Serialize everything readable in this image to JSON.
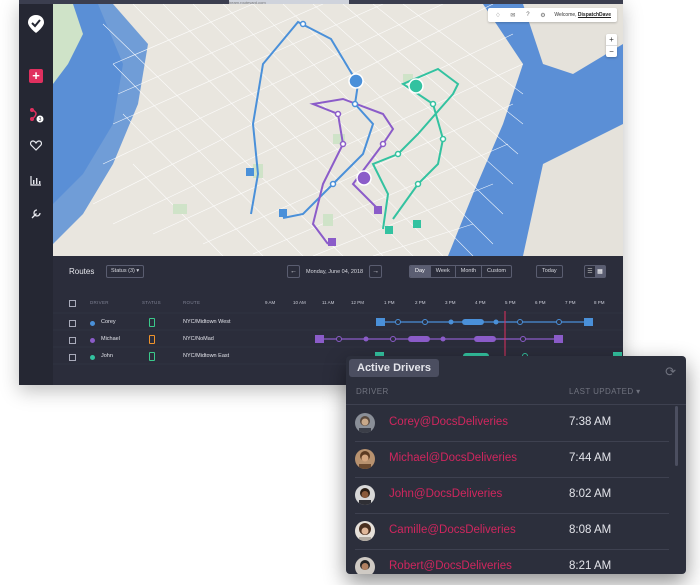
{
  "browser": {
    "url": "beam.routeyard.com"
  },
  "map_header": {
    "welcome": "Welcome,",
    "user": "DispatchDave"
  },
  "zoom": {
    "in": "+",
    "out": "−"
  },
  "routes_panel": {
    "title": "Routes",
    "status_filter": "Status (3)",
    "date": "Monday, June 04, 2018",
    "view_modes": [
      "Day",
      "Week",
      "Month",
      "Custom"
    ],
    "active_view": "Day",
    "today_label": "Today",
    "columns": {
      "driver": "DRIVER",
      "status": "STATUS",
      "route": "ROUTE"
    },
    "times": [
      "9 AM",
      "10 AM",
      "11 AM",
      "12 PM",
      "1 PM",
      "2 PM",
      "3 PM",
      "4 PM",
      "5 PM",
      "6 PM",
      "7 PM",
      "8 PM"
    ],
    "drivers": [
      {
        "name": "Corey",
        "route": "NYC/Midtown West",
        "color": "#4a90d9",
        "status_color": "#3bc98b"
      },
      {
        "name": "Michael",
        "route": "NYC/NoMad",
        "color": "#8b5cc9",
        "status_color": "#f0932b"
      },
      {
        "name": "John",
        "route": "NYC/Midtown East",
        "color": "#33c2a0",
        "status_color": "#3bc98b"
      }
    ]
  },
  "active_drivers": {
    "title": "Active Drivers",
    "columns": {
      "driver": "DRIVER",
      "last_updated": "LAST UPDATED ▾"
    },
    "rows": [
      {
        "name": "Corey@DocsDeliveries",
        "time": "7:38 AM"
      },
      {
        "name": "Michael@DocsDeliveries",
        "time": "7:44 AM"
      },
      {
        "name": "John@DocsDeliveries",
        "time": "8:02 AM"
      },
      {
        "name": "Camille@DocsDeliveries",
        "time": "8:08 AM"
      },
      {
        "name": "Robert@DocsDeliveries",
        "time": "8:21 AM"
      }
    ]
  },
  "colors": {
    "accent": "#d0265e",
    "blue_route": "#4a90d9",
    "purple_route": "#8b5cc9",
    "teal_route": "#33c2a0",
    "water": "#5b8fd6"
  }
}
